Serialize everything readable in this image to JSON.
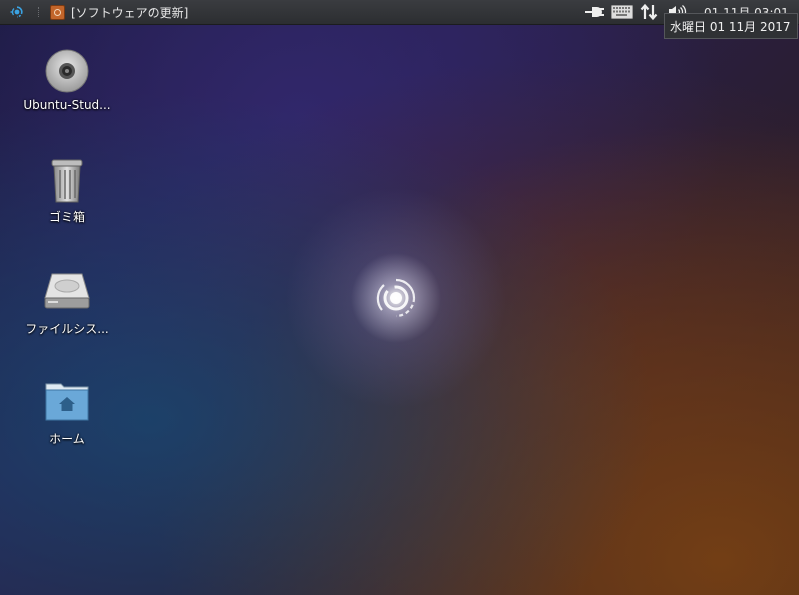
{
  "panel": {
    "task_title": "[ソフトウェアの更新]",
    "clock": "01 11月 03:01"
  },
  "tooltip": {
    "date": "水曜日 01 11月 2017"
  },
  "desktop_icons": [
    {
      "label": "Ubuntu-Stud...",
      "icon": "disc-icon"
    },
    {
      "label": "ゴミ箱",
      "icon": "trash-icon"
    },
    {
      "label": "ファイルシス...",
      "icon": "hard-drive-icon"
    },
    {
      "label": "ホーム",
      "icon": "home-folder-icon"
    }
  ],
  "colors": {
    "panel_bg": "#2c2e31",
    "text": "#e8e8e8",
    "launcher_blue": "#3aa3e3"
  }
}
